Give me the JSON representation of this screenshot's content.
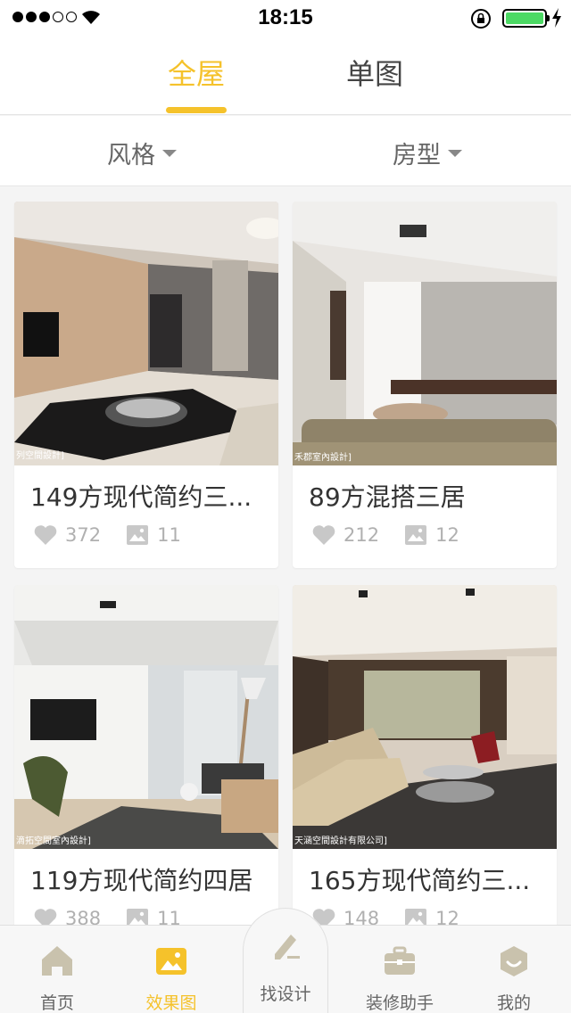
{
  "status_bar": {
    "time": "18:15",
    "signal_bars_filled": 3,
    "signal_bars_total": 5,
    "battery_level": 1.0,
    "icons": [
      "signal-icon",
      "wifi-icon",
      "rotation-lock-icon",
      "battery-icon",
      "charging-icon"
    ]
  },
  "top_tabs": [
    {
      "label": "全屋",
      "active": true
    },
    {
      "label": "单图",
      "active": false
    }
  ],
  "filters": [
    {
      "label": "风格",
      "icon": "caret-down-icon"
    },
    {
      "label": "房型",
      "icon": "caret-down-icon"
    }
  ],
  "cards": [
    {
      "title": "149方现代简约三...",
      "likes": "372",
      "images": "11",
      "watermark": "列空間設計]"
    },
    {
      "title": "89方混搭三居",
      "likes": "212",
      "images": "12",
      "watermark": "禾郡室內設計]"
    },
    {
      "title": "119方现代简约四居",
      "likes": "388",
      "images": "11",
      "watermark": "滴拓空間室內設計]"
    },
    {
      "title": "165方现代简约三...",
      "likes": "148",
      "images": "12",
      "watermark": "天涵空間設計有限公司]"
    }
  ],
  "bottom_nav": [
    {
      "label": "首页",
      "icon": "home-icon",
      "active": false
    },
    {
      "label": "效果图",
      "icon": "gallery-icon",
      "active": true
    },
    {
      "label": "找设计",
      "icon": "pen-icon",
      "active": false
    },
    {
      "label": "装修助手",
      "icon": "toolbox-icon",
      "active": false
    },
    {
      "label": "我的",
      "icon": "profile-icon",
      "active": false
    }
  ],
  "colors": {
    "accent": "#f5c22b",
    "text_primary": "#333333",
    "text_muted": "#b0b0b0",
    "background": "#f4f4f4",
    "battery": "#4cd964"
  }
}
